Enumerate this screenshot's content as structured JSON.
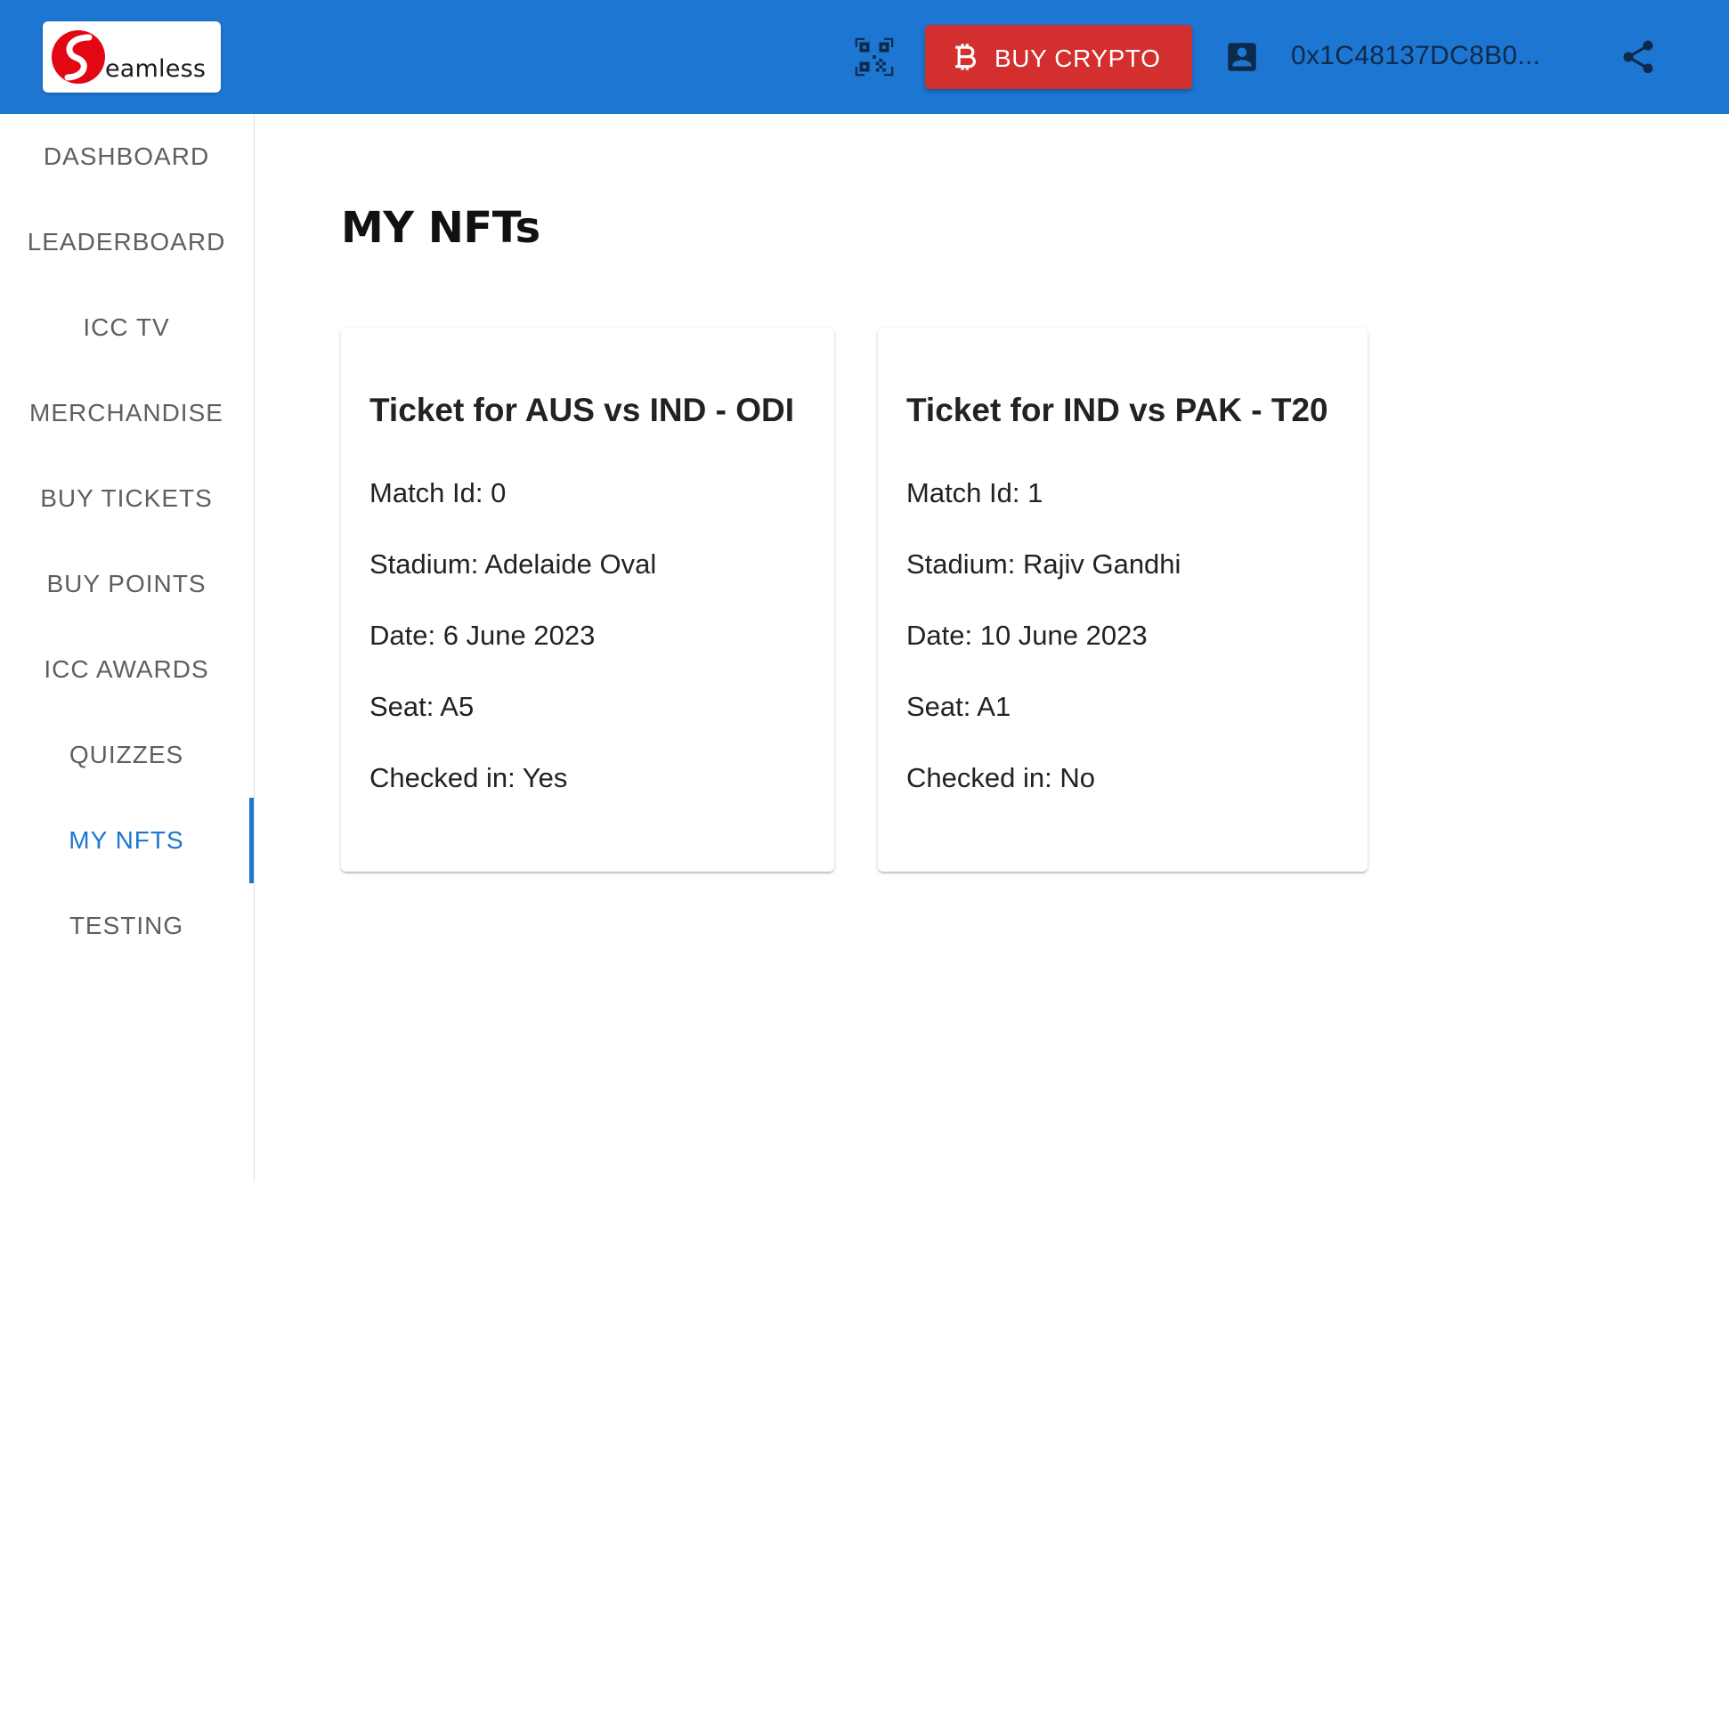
{
  "header": {
    "logo_text": "eamless",
    "logo_letter": "S",
    "buy_label": "BUY CRYPTO",
    "wallet_address": "0x1C48137DC8B0...",
    "icons": {
      "qr": "qr-code-scanner-icon",
      "bitcoin": "bitcoin-icon",
      "account": "account-box-icon",
      "share": "share-icon"
    },
    "colors": {
      "bar": "#1d76d2",
      "buy_button": "#d32f2f",
      "icon": "#0e2a4a"
    }
  },
  "sidebar": {
    "items": [
      {
        "label": "DASHBOARD"
      },
      {
        "label": "LEADERBOARD"
      },
      {
        "label": "ICC TV"
      },
      {
        "label": "MERCHANDISE"
      },
      {
        "label": "BUY TICKETS"
      },
      {
        "label": "BUY POINTS"
      },
      {
        "label": "ICC AWARDS"
      },
      {
        "label": "QUIZZES"
      },
      {
        "label": "MY NFTS",
        "active": true
      },
      {
        "label": "TESTING"
      }
    ],
    "active_color": "#1d76d2"
  },
  "main": {
    "title": "MY NFTs",
    "cards": [
      {
        "title": "Ticket for AUS vs IND - ODI",
        "match_id": "Match Id: 0",
        "stadium": "Stadium: Adelaide Oval",
        "date": "Date: 6 June 2023",
        "seat": "Seat: A5",
        "checked_in": "Checked in: Yes"
      },
      {
        "title": "Ticket for IND vs PAK - T20",
        "match_id": "Match Id: 1",
        "stadium": "Stadium: Rajiv Gandhi",
        "date": "Date: 10 June 2023",
        "seat": "Seat: A1",
        "checked_in": "Checked in: No"
      }
    ]
  }
}
